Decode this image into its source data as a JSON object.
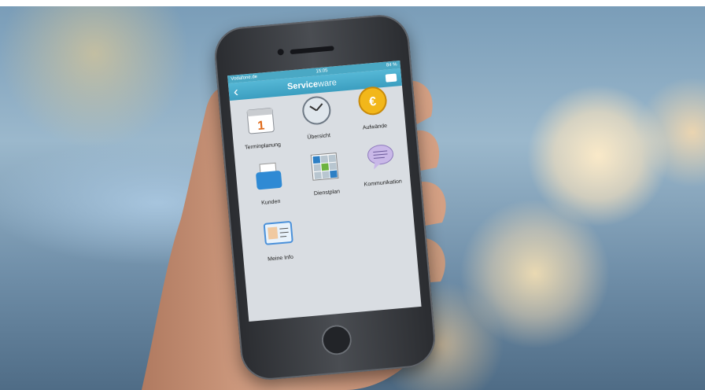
{
  "status_bar": {
    "carrier": "Vodafone.de",
    "time": "15:05",
    "battery": "84 %"
  },
  "app_bar": {
    "brand_strong": "Service",
    "brand_light": "ware"
  },
  "tiles": [
    {
      "label": "Terminplanung",
      "icon": "calendar-icon"
    },
    {
      "label": "Übersicht",
      "icon": "clock-icon"
    },
    {
      "label": "Aufwände",
      "icon": "euro-coin-icon"
    },
    {
      "label": "Kunden",
      "icon": "card-box-icon"
    },
    {
      "label": "Dienstplan",
      "icon": "schedule-grid-icon"
    },
    {
      "label": "Kommunikation",
      "icon": "speech-bubble-icon"
    },
    {
      "label": "Meine Info",
      "icon": "id-card-icon"
    }
  ]
}
